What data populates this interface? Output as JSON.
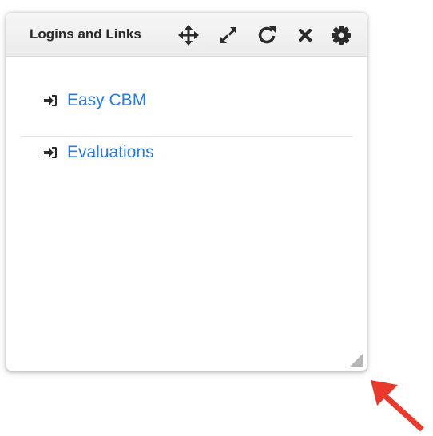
{
  "widget": {
    "title": "Logins and Links",
    "header_icons": [
      "move-icon",
      "expand-icon",
      "refresh-icon",
      "close-icon",
      "gear-icon"
    ],
    "links": [
      {
        "label": "Easy CBM",
        "icon": "sign-in-icon"
      },
      {
        "label": "Evaluations",
        "icon": "sign-in-icon"
      }
    ]
  },
  "colors": {
    "link": "#2a7ae2",
    "header_bg": "#efefef",
    "icon": "#2b2b2b",
    "annotation_arrow": "#e8392b"
  }
}
